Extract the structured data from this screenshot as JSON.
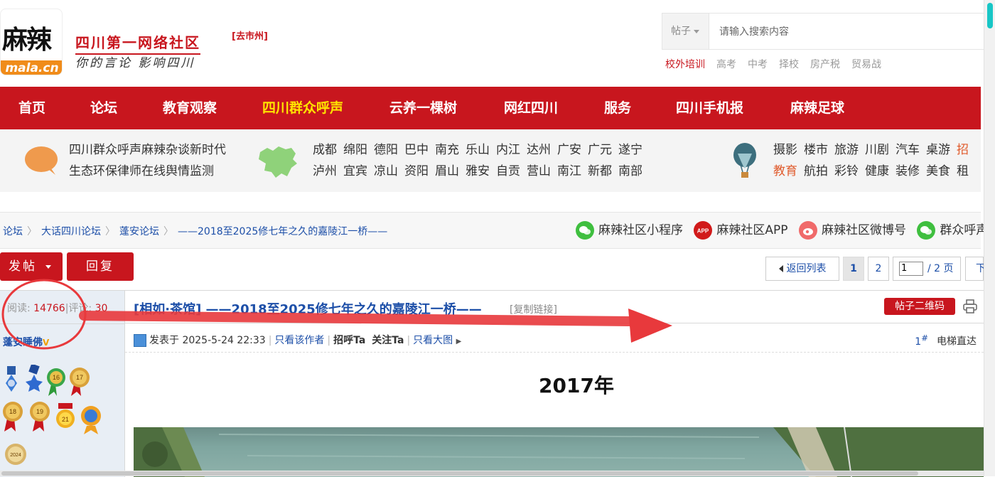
{
  "header": {
    "logo_text": "麻辣",
    "logo_sub": "mala.cn",
    "site_title": "四川第一网络社区",
    "slogan": "你的言论 影响四川",
    "city_link": "[去市州]",
    "search": {
      "type": "帖子",
      "placeholder": "请输入搜索内容"
    },
    "hot_tags": [
      "校外培训",
      "高考",
      "中考",
      "择校",
      "房产税",
      "贸易战"
    ]
  },
  "nav": {
    "items": [
      "首页",
      "论坛",
      "教育观察",
      "四川群众呼声",
      "云养一棵树",
      "网红四川",
      "服务",
      "四川手机报",
      "麻辣足球"
    ],
    "active_index": 3,
    "bg_color": "#c8161e",
    "active_color": "#ffe400"
  },
  "subband": {
    "voice_line1": "四川群众呼声麻辣杂谈新时代",
    "voice_line2": "生态环保律师在线舆情监测",
    "cities_row1": [
      "成都",
      "绵阳",
      "德阳",
      "巴中",
      "南充",
      "乐山",
      "内江",
      "达州",
      "广安",
      "广元",
      "遂宁"
    ],
    "cities_row2": [
      "泸州",
      "宜宾",
      "凉山",
      "资阳",
      "眉山",
      "雅安",
      "自贡",
      "营山",
      "南江",
      "新都",
      "南部"
    ],
    "topics_row1": [
      "摄影",
      "楼市",
      "旅游",
      "川剧",
      "汽车",
      "桌游",
      "招"
    ],
    "topics_row2": [
      "教育",
      "航拍",
      "彩铃",
      "健康",
      "装修",
      "美食",
      "租"
    ]
  },
  "breadcrumb": {
    "items": [
      "论坛",
      "大话四川论坛",
      "蓬安论坛",
      "——2018至2025修七年之久的嘉陵江一桥——"
    ]
  },
  "social": {
    "items": [
      {
        "label": "麻辣社区小程序",
        "icon": "wechat-icon"
      },
      {
        "label": "麻辣社区APP",
        "icon": "app-icon"
      },
      {
        "label": "麻辣社区微博号",
        "icon": "weibo-icon"
      },
      {
        "label": "群众呼声",
        "icon": "wechat-icon"
      }
    ],
    "app_badge": "APP"
  },
  "actions": {
    "post_label": "发帖",
    "reply_label": "回复",
    "back_label": "返回列表",
    "pages": [
      "1",
      "2"
    ],
    "page_input": "1",
    "page_total": "/ 2 页",
    "next_label": "下"
  },
  "post": {
    "stats_read_label": "阅读:",
    "stats_read": "14766",
    "stats_sep": "|",
    "stats_comment_label": "评论:",
    "stats_comment": "30",
    "title": "[相如·茶馆] ——2018至2025修七年之久的嘉陵江一桥——",
    "copy_link": "[复制链接]",
    "qr_button": "帖子二维码",
    "author": "蓬安睡佛",
    "posted_at": "发表于 2025-5-24 22:33",
    "only_author": "只看该作者",
    "greet": "招呼Ta",
    "follow": "关注Ta",
    "big_image": "只看大图",
    "floor": "1",
    "floor_mark": "#",
    "elevator": "电梯直达",
    "heading": "2017年",
    "medals": [
      "16",
      "17",
      "18",
      "19",
      "21",
      "2024"
    ]
  },
  "annotation": {
    "color": "#e8393c"
  }
}
